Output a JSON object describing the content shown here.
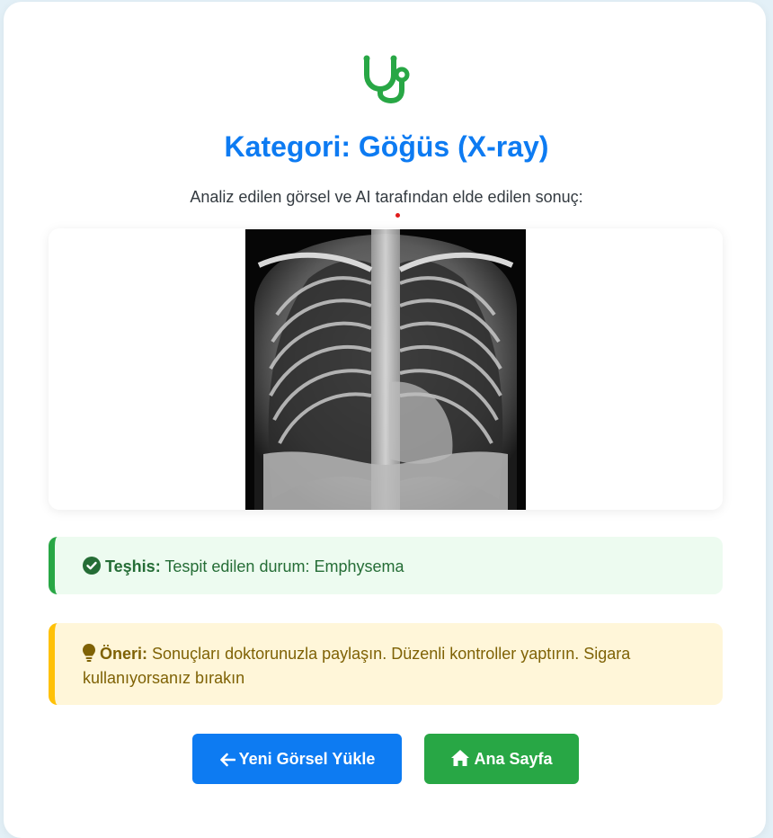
{
  "header": {
    "title": "Kategori: Göğüs (X-ray)",
    "subtitle": "Analiz edilen görsel ve AI tarafından elde edilen sonuç:",
    "icon": "stethoscope-icon"
  },
  "result_image": {
    "label": "chest x-ray image"
  },
  "diagnosis": {
    "label": "Teşhis:",
    "text": "Tespit edilen durum: Emphysema",
    "icon": "check-circle-icon",
    "color": "#28a745"
  },
  "advice": {
    "label": "Öneri:",
    "text": "Sonuçları doktorunuzla paylaşın. Düzenli kontroller yaptırın. Sigara kullanıyorsanız bırakın",
    "icon": "lightbulb-icon",
    "color": "#ffc107"
  },
  "actions": {
    "upload_label": "Yeni Görsel Yükle",
    "upload_icon": "arrow-left-icon",
    "home_label": "Ana Sayfa",
    "home_icon": "home-icon"
  },
  "colors": {
    "primary": "#0d7bf2",
    "success": "#28a745",
    "warning": "#ffc107"
  }
}
